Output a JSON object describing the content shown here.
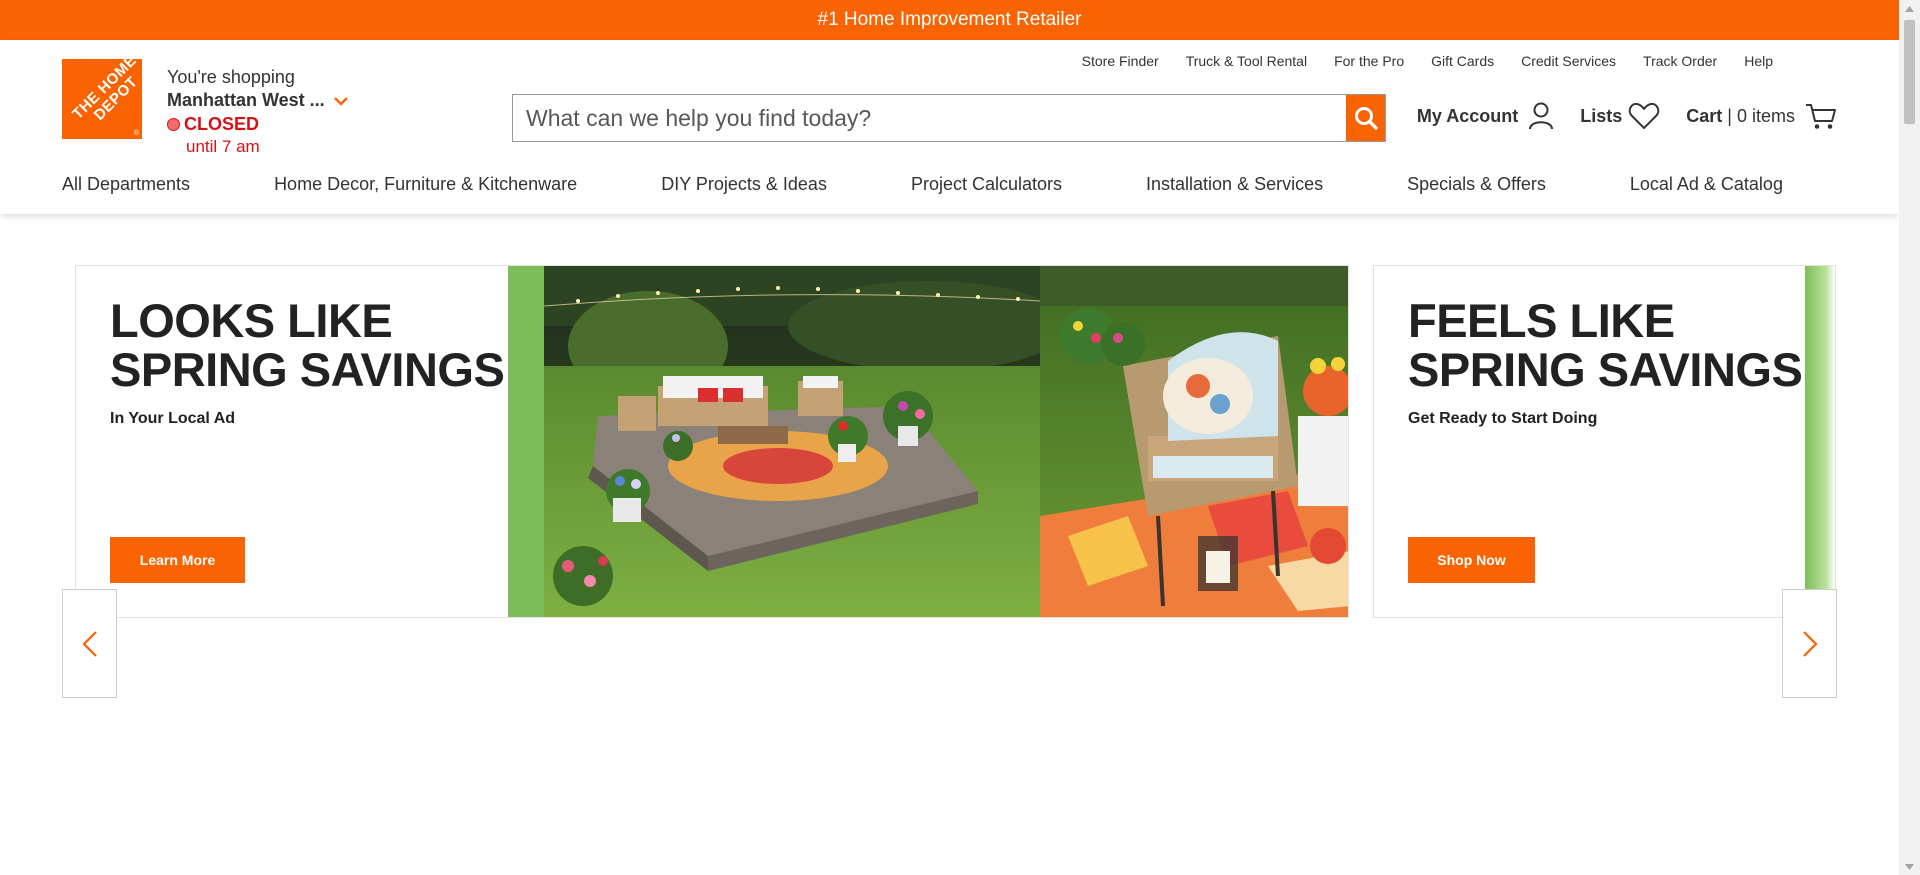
{
  "topbar": {
    "text": "#1 Home Improvement Retailer"
  },
  "logo": {
    "text": "THE HOME DEPOT",
    "brand_color": "#f96302"
  },
  "store": {
    "shopping_label": "You're shopping",
    "name": "Manhattan West ...",
    "status": "CLOSED",
    "until": "until 7 am",
    "status_color": "#d81118"
  },
  "utility_nav": [
    "Store Finder",
    "Truck & Tool Rental",
    "For the Pro",
    "Gift Cards",
    "Credit Services",
    "Track Order",
    "Help"
  ],
  "search": {
    "placeholder": "What can we help you find today?",
    "value": ""
  },
  "actions": {
    "account_label": "My Account",
    "lists_label": "Lists",
    "cart_label": "Cart",
    "cart_sep": "|",
    "cart_count": "0 items"
  },
  "main_nav": [
    "All Departments",
    "Home Decor, Furniture & Kitchenware",
    "DIY Projects & Ideas",
    "Project Calculators",
    "Installation & Services",
    "Specials & Offers",
    "Local Ad & Catalog"
  ],
  "carousel": {
    "slides": [
      {
        "title_line1": "LOOKS LIKE",
        "title_line2": "SPRING SAVINGS",
        "subtitle": "In Your Local Ad",
        "button": "Learn More"
      },
      {
        "title_line1": "FEELS LIKE",
        "title_line2": "SPRING SAVINGS",
        "subtitle": "Get Ready to Start Doing",
        "button": "Shop Now"
      }
    ]
  },
  "icons": {
    "search": "search-icon",
    "account": "user-icon",
    "lists": "heart-icon",
    "cart": "cart-icon",
    "chevron": "chevron-down-icon",
    "prev": "chevron-left-icon",
    "next": "chevron-right-icon"
  }
}
